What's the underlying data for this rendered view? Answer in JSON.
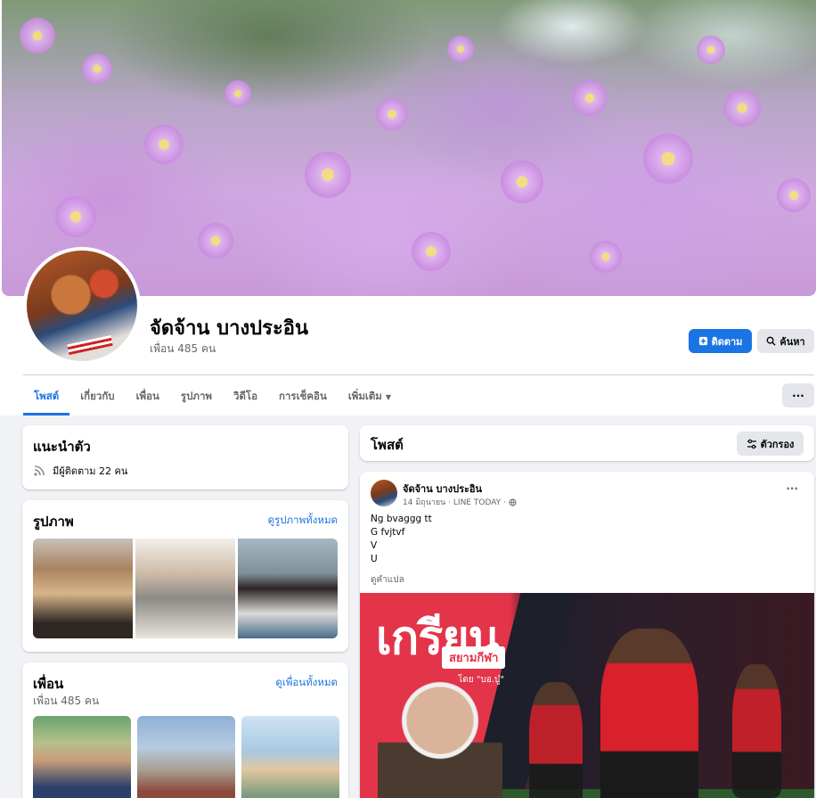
{
  "profile": {
    "name": "จัดจ้าน บางประอิน",
    "friends_count": "เพื่อน 485 คน"
  },
  "actions": {
    "follow_label": "ติดตาม",
    "search_label": "ค้นหา",
    "more_label": "···"
  },
  "tabs": [
    {
      "label": "โพสต์",
      "active": true
    },
    {
      "label": "เกี่ยวกับ",
      "active": false
    },
    {
      "label": "เพื่อน",
      "active": false
    },
    {
      "label": "รูปภาพ",
      "active": false
    },
    {
      "label": "วิดีโอ",
      "active": false
    },
    {
      "label": "การเช็คอิน",
      "active": false
    },
    {
      "label": "เพิ่มเติม",
      "active": false
    }
  ],
  "intro": {
    "title": "แนะนำตัว",
    "followers": "มีผู้ติดตาม 22 คน"
  },
  "photos": {
    "title": "รูปภาพ",
    "see_all": "ดูรูปภาพทั้งหมด"
  },
  "friends": {
    "title": "เพื่อน",
    "count": "เพื่อน 485 คน",
    "see_all": "ดูเพื่อนทั้งหมด"
  },
  "posts": {
    "title": "โพสต์",
    "filter_label": "ตัวกรอง"
  },
  "post": {
    "author": "จัดจ้าน บางประอิน",
    "meta": "14 มิถุนายน · LINE TODAY ·",
    "lines": [
      "Ng bvaggg tt",
      "G fvjtvf",
      "V",
      "U"
    ],
    "translate": "ดูคำแปล",
    "image_title": "เกรียน",
    "image_subtitle": "สยามกีฬา",
    "image_byline": "โดย \"บอ.บู๋\""
  },
  "colors": {
    "accent": "#1b74e4",
    "background": "#f0f2f5"
  }
}
